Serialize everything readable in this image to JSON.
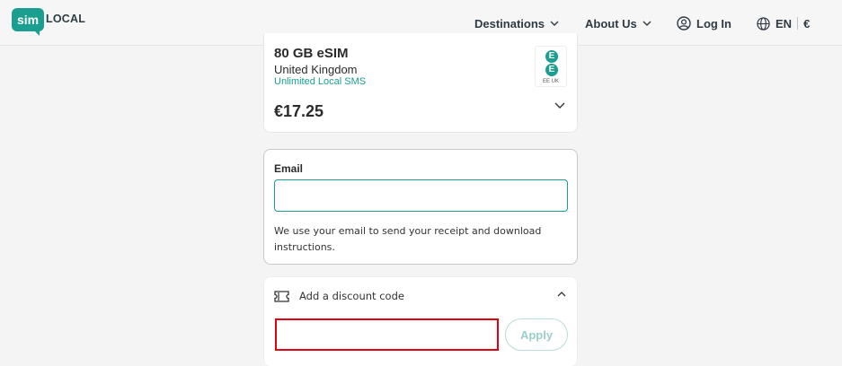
{
  "header": {
    "logo": {
      "sim": "sim",
      "local": "LOCAL"
    },
    "nav": {
      "destinations": "Destinations",
      "about": "About Us",
      "login": "Log In",
      "language": "EN",
      "currency": "€"
    }
  },
  "plan": {
    "name": "80 GB eSIM",
    "country": "United Kingdom",
    "feature": "Unlimited Local SMS",
    "price": "€17.25",
    "carrier_logo": {
      "letter1": "E",
      "letter2": "E",
      "label": "EE UK"
    }
  },
  "email": {
    "label": "Email",
    "value": "",
    "placeholder": "",
    "help": "We use your email to send your receipt and download instructions."
  },
  "discount": {
    "label": "Add a discount code",
    "value": "",
    "apply_label": "Apply"
  },
  "colors": {
    "brand": "#1a9e8f",
    "highlight": "#e0000f"
  }
}
